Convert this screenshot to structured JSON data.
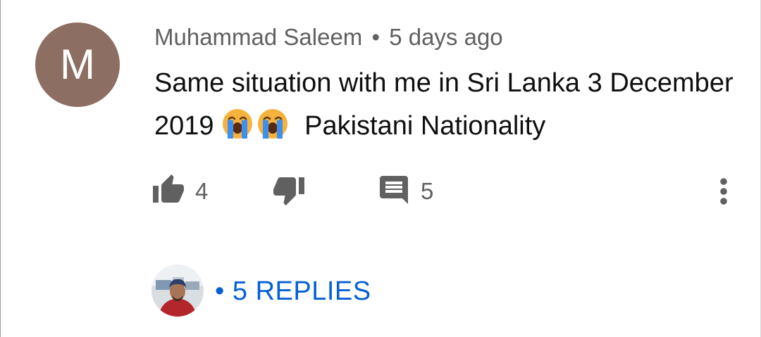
{
  "comment": {
    "avatar_letter": "M",
    "avatar_color": "#8d6e63",
    "author": "Muhammad Saleem",
    "separator": "•",
    "time": "5 days ago",
    "text_before_emoji": "Same situation with me in Sri Lanka 3 December 2019",
    "emojis": [
      "loudly-crying-face",
      "loudly-crying-face"
    ],
    "text_after_emoji": "Pakistani Nationality"
  },
  "actions": {
    "like_count": "4",
    "reply_count": "5"
  },
  "replies": {
    "separator": "•",
    "label": "5 REPLIES",
    "link_color": "#065fd4"
  }
}
